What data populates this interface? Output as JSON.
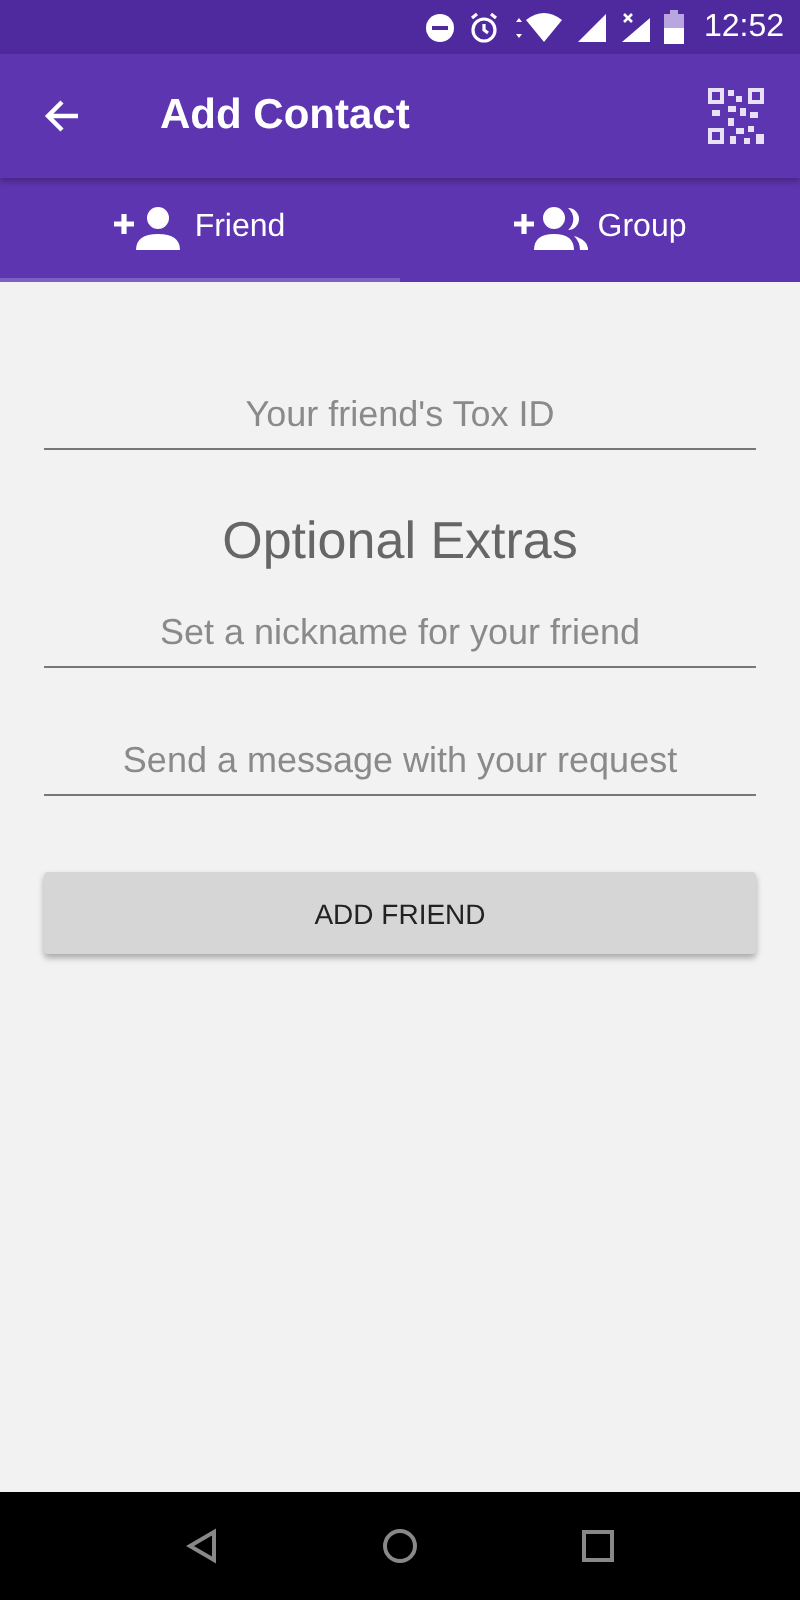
{
  "status_bar": {
    "time": "12:52"
  },
  "app_bar": {
    "title": "Add Contact"
  },
  "tabs": [
    {
      "label": "Friend",
      "kind": "friend",
      "selected": true
    },
    {
      "label": "Group",
      "kind": "group",
      "selected": false
    }
  ],
  "form": {
    "tox_id": {
      "placeholder": "Your friend's Tox ID"
    },
    "section_title": "Optional Extras",
    "fields": [
      {
        "placeholder": "Set a nickname for your friend"
      },
      {
        "placeholder": "Send a message with your request"
      }
    ],
    "button": "ADD FRIEND"
  }
}
